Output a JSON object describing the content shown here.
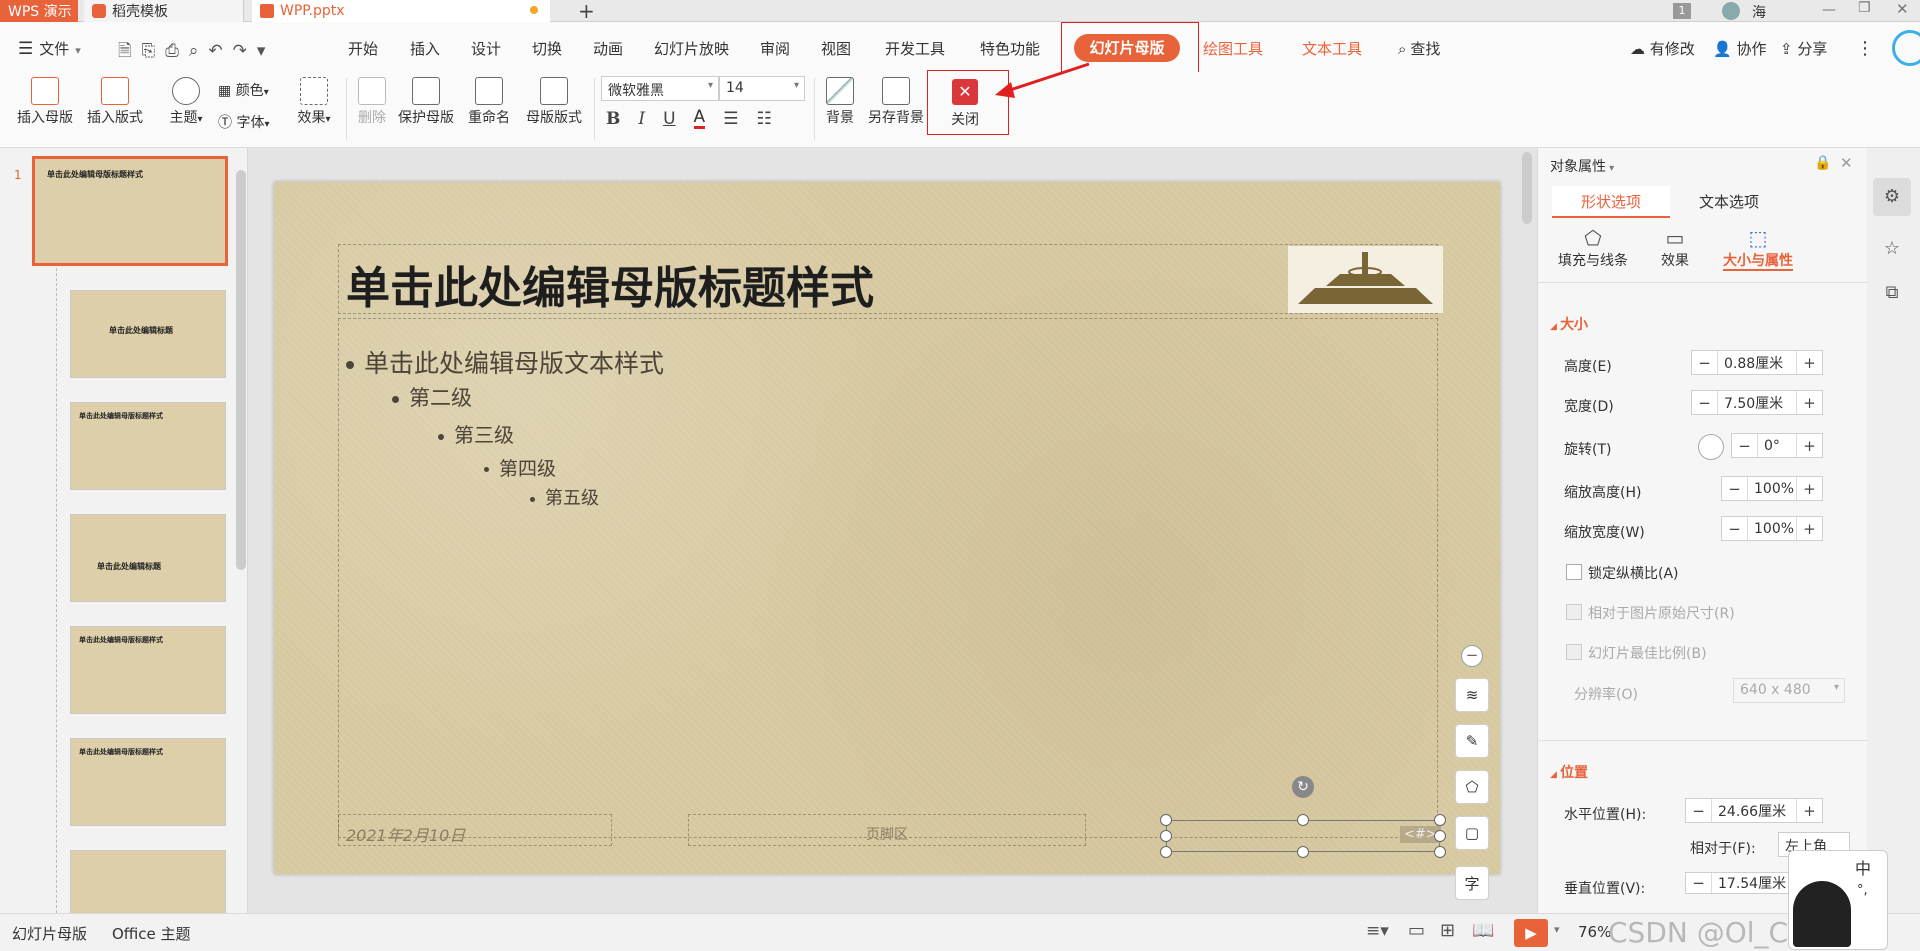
{
  "tabs": {
    "app": "WPS 演示",
    "template": "稻壳模板",
    "file": "WPP.pptx",
    "add": "+",
    "page_badge": "1",
    "user": "海"
  },
  "menu": {
    "file": "文件",
    "items": [
      "开始",
      "插入",
      "设计",
      "切换",
      "动画",
      "幻灯片放映",
      "审阅",
      "视图",
      "开发工具",
      "特色功能"
    ],
    "active": "幻灯片母版",
    "context": [
      "绘图工具",
      "文本工具"
    ],
    "search": "查找",
    "right": [
      "有修改",
      "协作",
      "分享"
    ]
  },
  "ribbon": {
    "insert_master": "插入母版",
    "insert_layout": "插入版式",
    "theme": "主题",
    "color": "颜色",
    "font": "字体",
    "effect": "效果",
    "delete": "删除",
    "protect_master": "保护母版",
    "rename": "重命名",
    "master_layout": "母版版式",
    "font_name": "微软雅黑",
    "font_size": "14",
    "bold": "B",
    "italic": "I",
    "underline": "U",
    "font_color": "A",
    "background": "背景",
    "save_background": "另存背景",
    "close": "关闭"
  },
  "left_panel": {
    "slide_number": "1",
    "thumbs": [
      {
        "title": "单击此处编辑母版标题样式"
      },
      {
        "title": "单击此处编辑标题"
      },
      {
        "title": "单击此处编辑母版标题样式"
      },
      {
        "title": "单击此处编辑标题"
      },
      {
        "title": "单击此处编辑母版标题样式"
      },
      {
        "title": "单击此处编辑母版标题样式"
      },
      {
        "title": ""
      }
    ]
  },
  "slide": {
    "title": "单击此处编辑母版标题样式",
    "levels": [
      "单击此处编辑母版文本样式",
      "第二级",
      "第三级",
      "第四级",
      "第五级"
    ],
    "date": "2021年2月10日",
    "footer": "页脚区",
    "page_num": "<#>"
  },
  "right_panel": {
    "header": "对象属性",
    "tab_shape": "形状选项",
    "tab_text": "文本选项",
    "sub_fill": "填充与线条",
    "sub_effect": "效果",
    "sub_size": "大小与属性",
    "section_size": "大小",
    "height_label": "高度(E)",
    "height_value": "0.88厘米",
    "width_label": "宽度(D)",
    "width_value": "7.50厘米",
    "rotate_label": "旋转(T)",
    "rotate_value": "0°",
    "scale_h_label": "缩放高度(H)",
    "scale_h_value": "100%",
    "scale_w_label": "缩放宽度(W)",
    "scale_w_value": "100%",
    "lock_ratio": "锁定纵横比(A)",
    "relative_original": "相对于图片原始尺寸(R)",
    "best_ratio": "幻灯片最佳比例(B)",
    "resolution_label": "分辨率(O)",
    "resolution_value": "640 x 480",
    "section_position": "位置",
    "hpos_label": "水平位置(H):",
    "hpos_value": "24.66厘米",
    "relative_to_label": "相对于(F):",
    "relative_to_value": "左上角",
    "vpos_label": "垂直位置(V):",
    "vpos_value": "17.54厘米"
  },
  "status": {
    "mode": "幻灯片母版",
    "theme": "Office 主题",
    "zoom": "76%",
    "watermark": "CSDN @Ol_Correct"
  },
  "ime": {
    "lang": "中",
    "punct": "°,"
  },
  "colors": {
    "accent": "#e8623a",
    "close_red": "#d9373a",
    "annotation_red": "#e02020"
  }
}
